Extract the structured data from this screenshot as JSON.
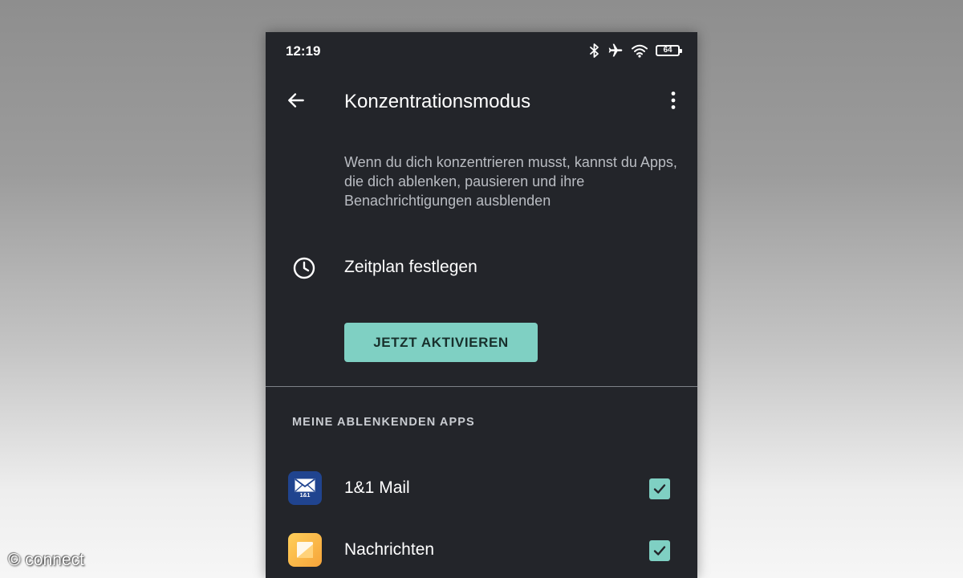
{
  "status_bar": {
    "time": "12:19",
    "battery_level": "64",
    "icons": [
      "bluetooth-icon",
      "airplane-mode-icon",
      "wifi-icon",
      "battery-icon"
    ]
  },
  "header": {
    "title": "Konzentrationsmodus",
    "back_icon": "arrow-back-icon",
    "menu_icon": "more-vert-icon"
  },
  "description": "Wenn du dich konzentrieren musst, kannst du Apps, die dich ablenken, pausieren und ihre Benachrichtigungen ausblenden",
  "schedule": {
    "label": "Zeitplan festlegen",
    "icon": "clock-icon"
  },
  "activate_button": "JETZT AKTIVIEREN",
  "section_header": "MEINE ABLENKENDEN APPS",
  "apps": [
    {
      "name": "1&1 Mail",
      "icon_badge": "1&1",
      "checked": true
    },
    {
      "name": "Nachrichten",
      "checked": true
    }
  ],
  "watermark": "© connect",
  "colors": {
    "screen_background": "#23252a",
    "accent": "#7fd0c3",
    "mail_icon": "#20448f",
    "messages_icon": "#f6a43a"
  }
}
